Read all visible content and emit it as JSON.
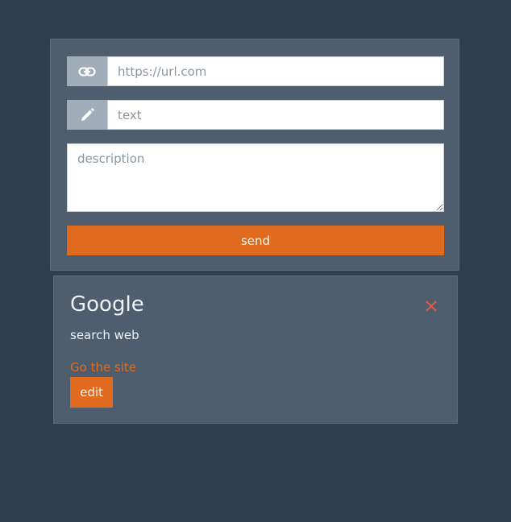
{
  "form": {
    "url_field": {
      "placeholder": "https://url.com",
      "icon": "link-icon"
    },
    "text_field": {
      "placeholder": "text",
      "icon": "pencil-icon"
    },
    "description_field": {
      "placeholder": "description"
    },
    "send_label": "send"
  },
  "card": {
    "title": "Google",
    "description": "search web",
    "link_label": "Go the site",
    "edit_label": "edit",
    "close_icon": "close-icon"
  },
  "colors": {
    "background": "#2e3e50",
    "panel": "#4e5e6e",
    "accent": "#e06b1e",
    "addon": "#a1adb8",
    "close": "#e05a4a"
  }
}
